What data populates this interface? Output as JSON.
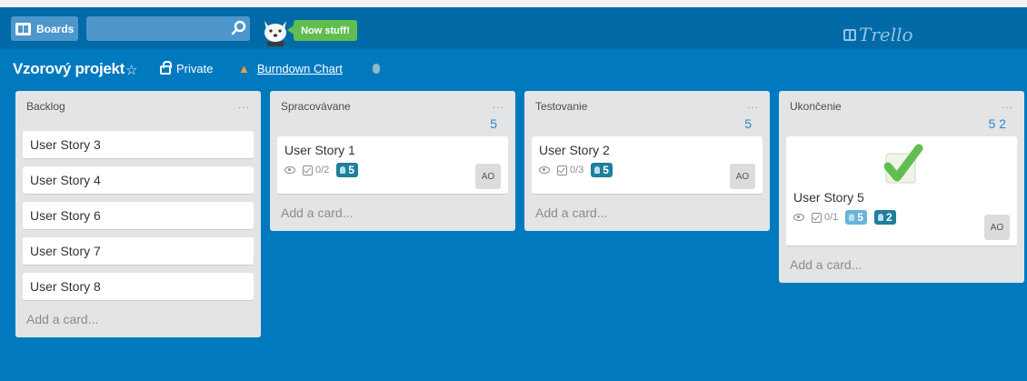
{
  "topbar": {
    "boards_label": "Boards",
    "new_stuff": "Now stuff!",
    "logo_text": "Trello"
  },
  "board": {
    "title": "Vzorový projekt",
    "visibility": "Private",
    "burndown_link": "Burndown Chart"
  },
  "lists": [
    {
      "title": "Backlog",
      "menu": "...",
      "cards": [
        {
          "title": "User Story 3"
        },
        {
          "title": "User Story 4"
        },
        {
          "title": "User Story 6"
        },
        {
          "title": "User Story 7"
        },
        {
          "title": "User Story 8"
        }
      ],
      "add_card": "Add a card..."
    },
    {
      "title": "Spracovávane",
      "menu": "...",
      "count": "5",
      "cards": [
        {
          "title": "User Story 1",
          "checklist": "0/2",
          "points": "5",
          "avatar": "AO"
        }
      ],
      "add_card": "Add a card..."
    },
    {
      "title": "Testovanie",
      "menu": "...",
      "count": "5",
      "cards": [
        {
          "title": "User Story 2",
          "checklist": "0/3",
          "points": "5",
          "avatar": "AO"
        }
      ],
      "add_card": "Add a card..."
    },
    {
      "title": "Ukončenie",
      "menu": "...",
      "count": "5 2",
      "cards": [
        {
          "title": "User Story 5",
          "checklist": "0/1",
          "points_a": "5",
          "points_b": "2",
          "avatar": "AO"
        }
      ],
      "add_card": "Add a card..."
    }
  ],
  "colors": {
    "background": "#0079bf",
    "header": "#026aa7",
    "list": "#e2e4e6",
    "new_stuff_badge": "#61bd4f",
    "checkmark": "#61bd4f"
  },
  "icons": [
    "boards-icon",
    "search-icon",
    "mascot-icon",
    "trello-logo-icon",
    "star-icon",
    "lock-icon",
    "fire-icon",
    "eye-icon",
    "checklist-icon",
    "lightbulb-icon",
    "checkmark-icon"
  ]
}
